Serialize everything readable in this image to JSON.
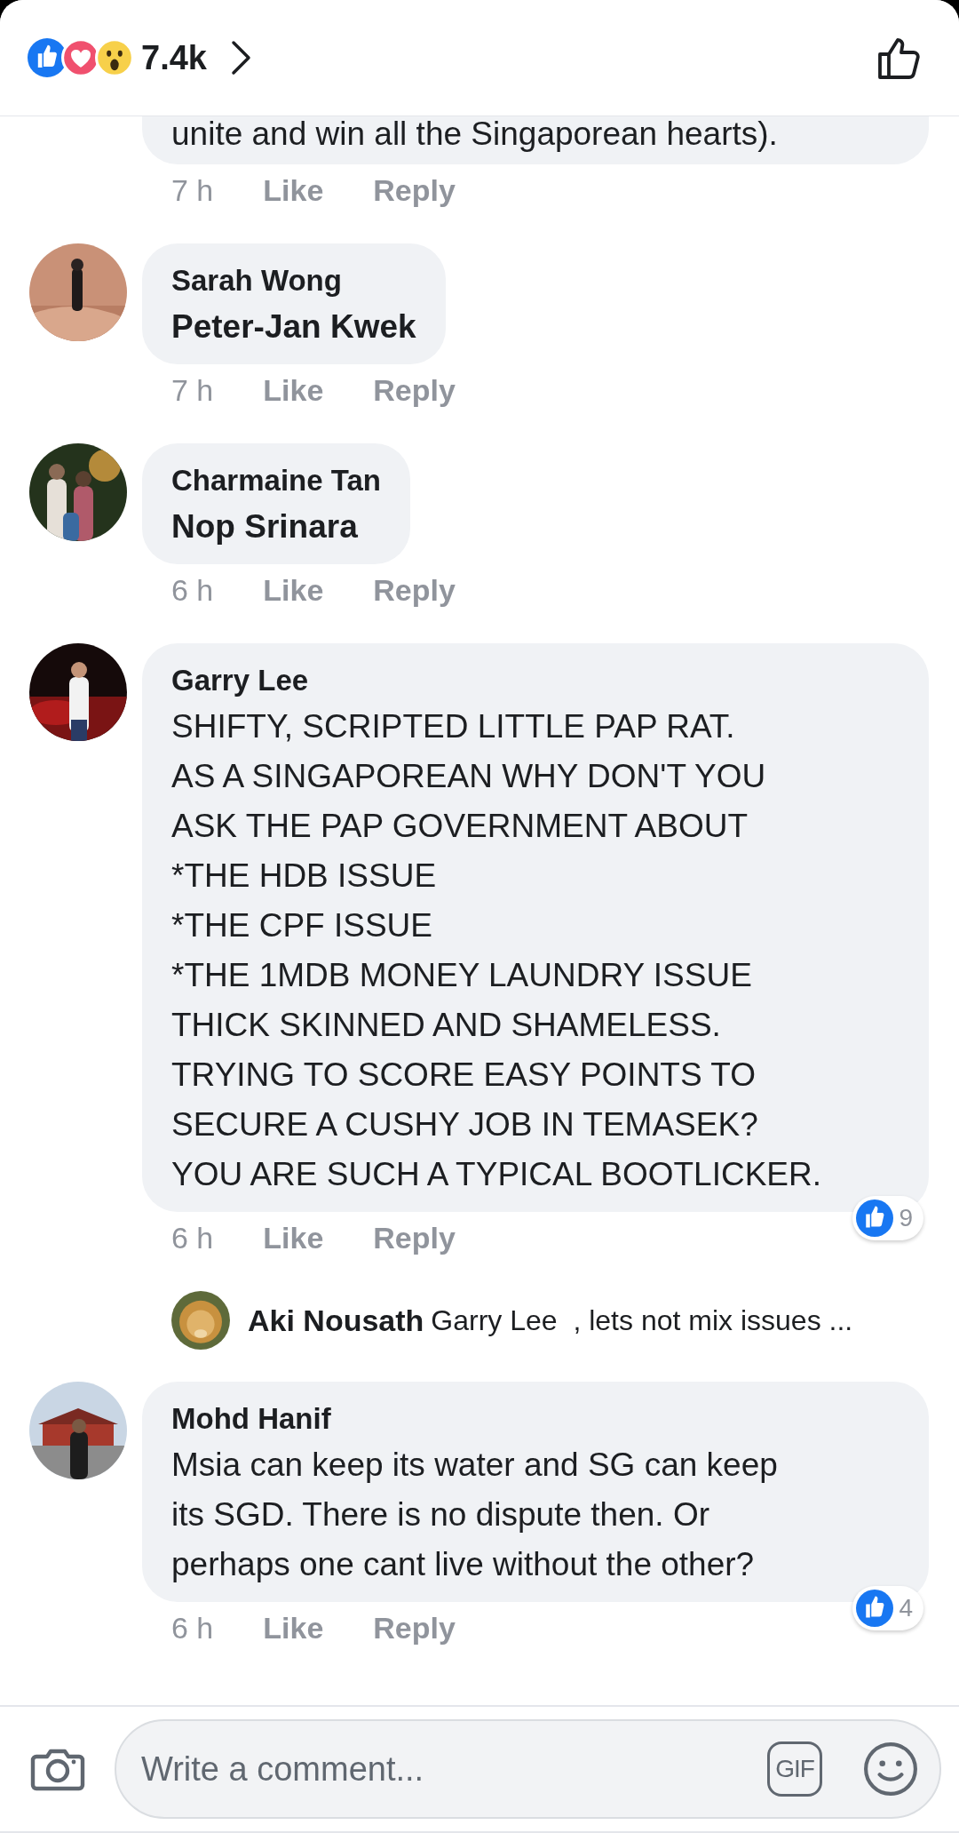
{
  "header": {
    "reaction_count": "7.4k"
  },
  "comments": [
    {
      "kind": "partial",
      "text": "unite and win all the Singaporean hearts).",
      "time": "7 h",
      "like": "Like",
      "reply": "Reply"
    },
    {
      "kind": "mention",
      "name": "Sarah Wong",
      "text": "Peter-Jan Kwek",
      "time": "7 h",
      "like": "Like",
      "reply": "Reply"
    },
    {
      "kind": "mention",
      "name": "Charmaine Tan",
      "text": "Nop Srinara",
      "time": "6 h",
      "like": "Like",
      "reply": "Reply"
    },
    {
      "kind": "text",
      "name": "Garry Lee",
      "text": "SHIFTY, SCRIPTED LITTLE PAP RAT.\nAS A SINGAPOREAN WHY DON'T YOU\nASK THE PAP GOVERNMENT ABOUT\n*THE HDB ISSUE\n*THE CPF ISSUE\n*THE 1MDB MONEY LAUNDRY ISSUE\nTHICK SKINNED AND SHAMELESS.\nTRYING TO SCORE EASY POINTS TO\nSECURE A CUSHY JOB IN TEMASEK?\nYOU ARE SUCH A TYPICAL BOOTLICKER.",
      "time": "6 h",
      "like": "Like",
      "reply": "Reply",
      "reaction_count": "9",
      "replies": [
        {
          "name": "Aki Nousath",
          "text": "Garry Lee  , lets not mix issues ..."
        }
      ]
    },
    {
      "kind": "text",
      "name": "Mohd Hanif",
      "text": "Msia can keep its water and SG can keep\nits SGD. There is no dispute then. Or\nperhaps one cant live without the other?",
      "time": "6 h",
      "like": "Like",
      "reply": "Reply",
      "reaction_count": "4"
    }
  ],
  "composer": {
    "placeholder": "Write a comment...",
    "gif_label": "GIF"
  }
}
